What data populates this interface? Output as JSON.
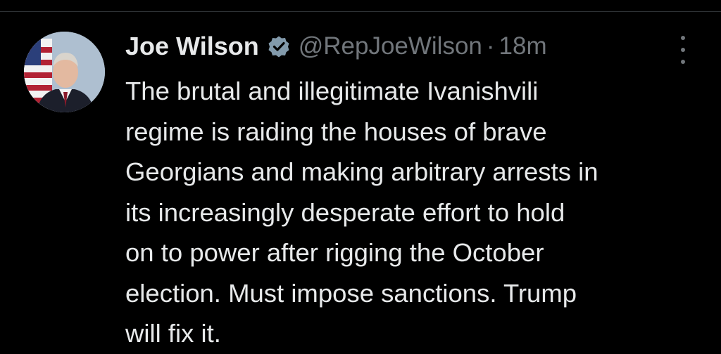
{
  "tweet": {
    "author": {
      "display_name": "Joe Wilson",
      "handle": "@RepJoeWilson",
      "verified": true,
      "avatar_icon": "profile-photo"
    },
    "separator": "·",
    "time": "18m",
    "more_icon": "more-options-icon",
    "text_lines": [
      "The brutal and illegitimate Ivanishvili",
      "regime is raiding the houses of brave",
      "Georgians and making arbitrary arrests in",
      "its increasingly desperate effort to hold",
      "on to power after rigging the October",
      "election. Must impose sanctions. Trump",
      "will fix it."
    ]
  },
  "colors": {
    "background": "#000000",
    "text_primary": "#e7e9ea",
    "text_secondary": "#71767b",
    "divider": "#2f3336",
    "verified_badge": "#829aab"
  }
}
